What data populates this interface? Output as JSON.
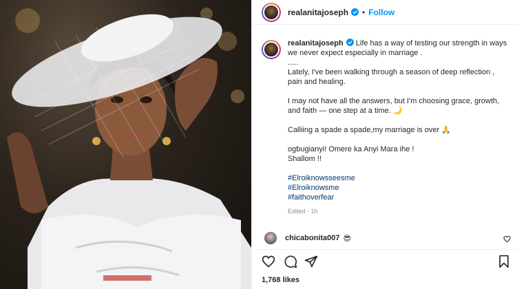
{
  "post": {
    "author": {
      "username": "realanitajoseph",
      "follow_label": "Follow"
    },
    "caption": {
      "username": "realanitajoseph",
      "paragraphs": [
        "Life has a way of testing our strength in ways we never expect especially in marriage .",
        ".....",
        "Lately, I've been walking through a season of deep reflection , pain and healing.",
        "I may not have all the answers, but I'm choosing grace, growth, and faith — one step at a time. 🌙",
        "Calliing a spade a spade,my marriage is over 🙏",
        "ogbugianyi! Omere ka Anyi Mara ihe !",
        "Shallom !!"
      ],
      "hashtags": [
        "#Elroiknowsseesme",
        "#Elroiknowsme",
        "#faithoverfear"
      ],
      "edited": "Edited · 1h"
    },
    "comment": {
      "username": "chicabonita007",
      "text": "😎"
    },
    "likes": "1,768 likes",
    "colors": {
      "accent": "#0095f6",
      "hashtag": "#00376b",
      "muted": "#8e8e8e"
    },
    "icons": [
      "verified-icon",
      "heart-icon",
      "comment-icon",
      "share-icon",
      "bookmark-icon"
    ]
  }
}
